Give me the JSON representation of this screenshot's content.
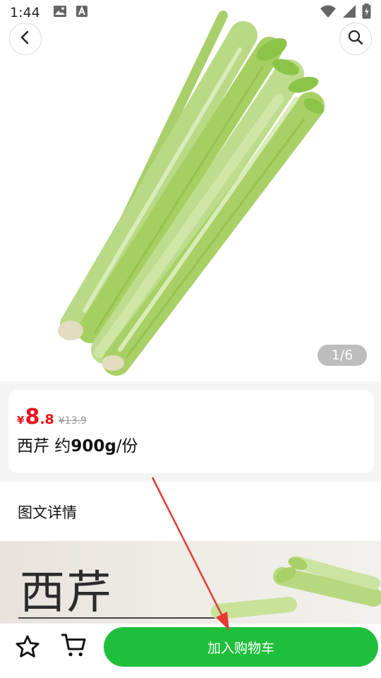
{
  "status_bar": {
    "time": "1:44",
    "icons": [
      "image-icon",
      "text-icon",
      "wifi-icon",
      "signal-icon",
      "battery-icon"
    ]
  },
  "hero": {
    "page_indicator": "1/6",
    "back_icon": "chevron-left-icon",
    "search_icon": "search-icon"
  },
  "product": {
    "price_symbol": "¥",
    "price_int": "8",
    "price_dec": ".8",
    "price_old": "¥13.9",
    "title_prefix": "西芹 约",
    "title_bold": "900g",
    "title_suffix": "/份"
  },
  "details": {
    "title": "图文详情",
    "banner_text": "西芹"
  },
  "bottom_bar": {
    "favorite_icon": "star-icon",
    "cart_icon": "cart-icon",
    "add_to_cart": "加入购物车"
  },
  "colors": {
    "price": "#e8131b",
    "accent_green": "#1fbf3c",
    "annotation_arrow": "#e53935"
  }
}
